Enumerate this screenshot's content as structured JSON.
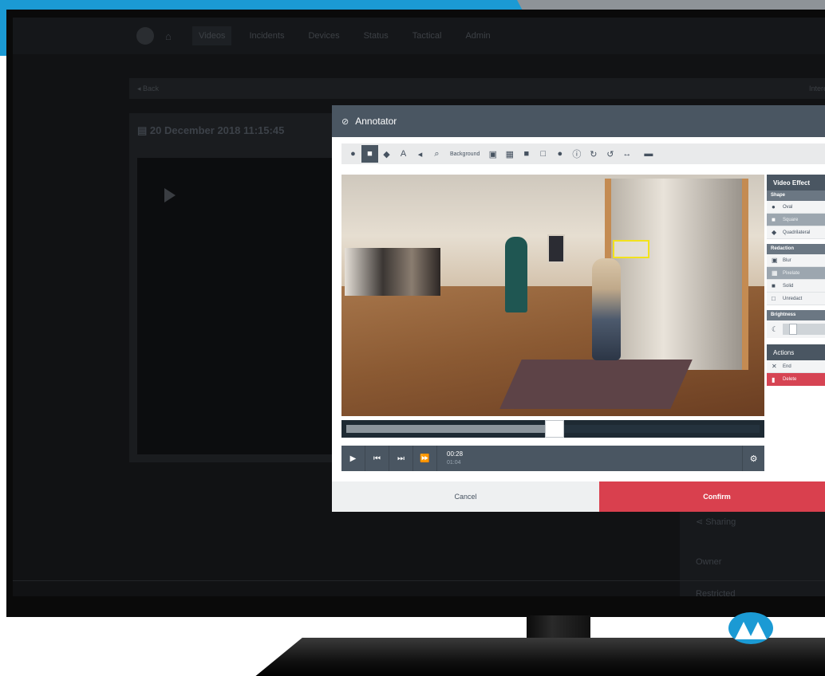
{
  "nav": {
    "items": [
      "Videos",
      "Incidents",
      "Devices",
      "Status",
      "Tactical",
      "Admin"
    ]
  },
  "app": {
    "back_label": "◂ Back",
    "right_label": "Interest",
    "panel_title": "20 December 2018 11:15:45",
    "sharing": {
      "title": "Sharing",
      "owner_label": "Owner",
      "restricted_label": "Restricted"
    }
  },
  "modal": {
    "title": "Annotator",
    "toolbar": {
      "background_label": "Background"
    },
    "effects": {
      "title": "Video Effect",
      "shape_title": "Shape",
      "shapes": [
        {
          "label": "Oval",
          "icon": "circle-icon",
          "selected": false
        },
        {
          "label": "Square",
          "icon": "square-icon",
          "selected": true
        },
        {
          "label": "Quadrilateral",
          "icon": "diamond-icon",
          "selected": false
        }
      ],
      "redaction_title": "Redaction",
      "redactions": [
        {
          "label": "Blur",
          "icon": "blur-icon",
          "selected": false
        },
        {
          "label": "Pixelate",
          "icon": "pixelate-icon",
          "selected": true
        },
        {
          "label": "Solid",
          "icon": "solid-icon",
          "selected": false
        },
        {
          "label": "Unredact",
          "icon": "unredact-icon",
          "selected": false
        }
      ],
      "brightness_title": "Brightness",
      "actions_title": "Actions",
      "end_label": "End",
      "delete_label": "Delete"
    },
    "player": {
      "current_time": "00:28",
      "total_time": "01:04",
      "progress": 0.48
    },
    "footer": {
      "cancel_label": "Cancel",
      "confirm_label": "Confirm"
    }
  },
  "colors": {
    "accent_blue": "#1b9ad4",
    "header_slate": "#4a5662",
    "confirm_red": "#d9404e"
  }
}
